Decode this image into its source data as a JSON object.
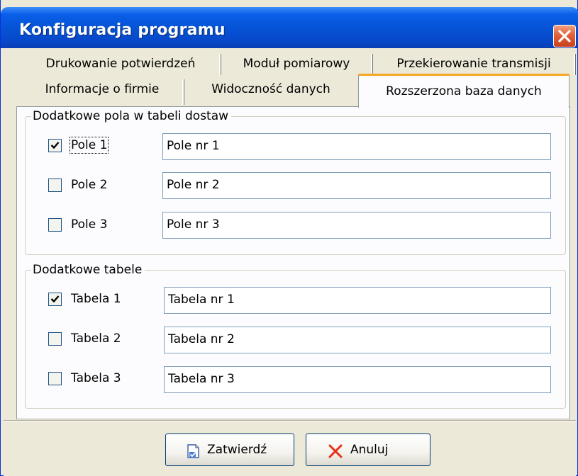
{
  "window": {
    "title": "Konfiguracja programu"
  },
  "tabs": {
    "row1": [
      {
        "label": "Drukowanie potwierdzeń"
      },
      {
        "label": "Moduł pomiarowy"
      },
      {
        "label": "Przekierowanie transmisji"
      }
    ],
    "row2": [
      {
        "label": "Informacje o firmie"
      },
      {
        "label": "Widoczność danych"
      },
      {
        "label": "Rozszerzona baza danych",
        "active": true
      }
    ]
  },
  "groups": [
    {
      "title": "Dodatkowe pola w tabeli dostaw",
      "rows": [
        {
          "label": "Pole 1",
          "checked": true,
          "value": "Pole nr 1"
        },
        {
          "label": "Pole 2",
          "checked": false,
          "value": "Pole nr 2"
        },
        {
          "label": "Pole 3",
          "checked": false,
          "value": "Pole nr 3"
        }
      ]
    },
    {
      "title": "Dodatkowe tabele",
      "rows": [
        {
          "label": "Tabela 1",
          "checked": true,
          "value": "Tabela nr 1"
        },
        {
          "label": "Tabela 2",
          "checked": false,
          "value": "Tabela nr 2"
        },
        {
          "label": "Tabela 3",
          "checked": false,
          "value": "Tabela nr 3"
        }
      ]
    }
  ],
  "buttons": {
    "confirm": {
      "label": "Zatwierdź",
      "icon": "confirm-document-icon"
    },
    "cancel": {
      "label": "Anuluj",
      "icon": "x-icon"
    }
  },
  "colors": {
    "titlebar": "#0553d6",
    "active_tab_accent": "#f5a623",
    "close_button": "#e0613a"
  }
}
